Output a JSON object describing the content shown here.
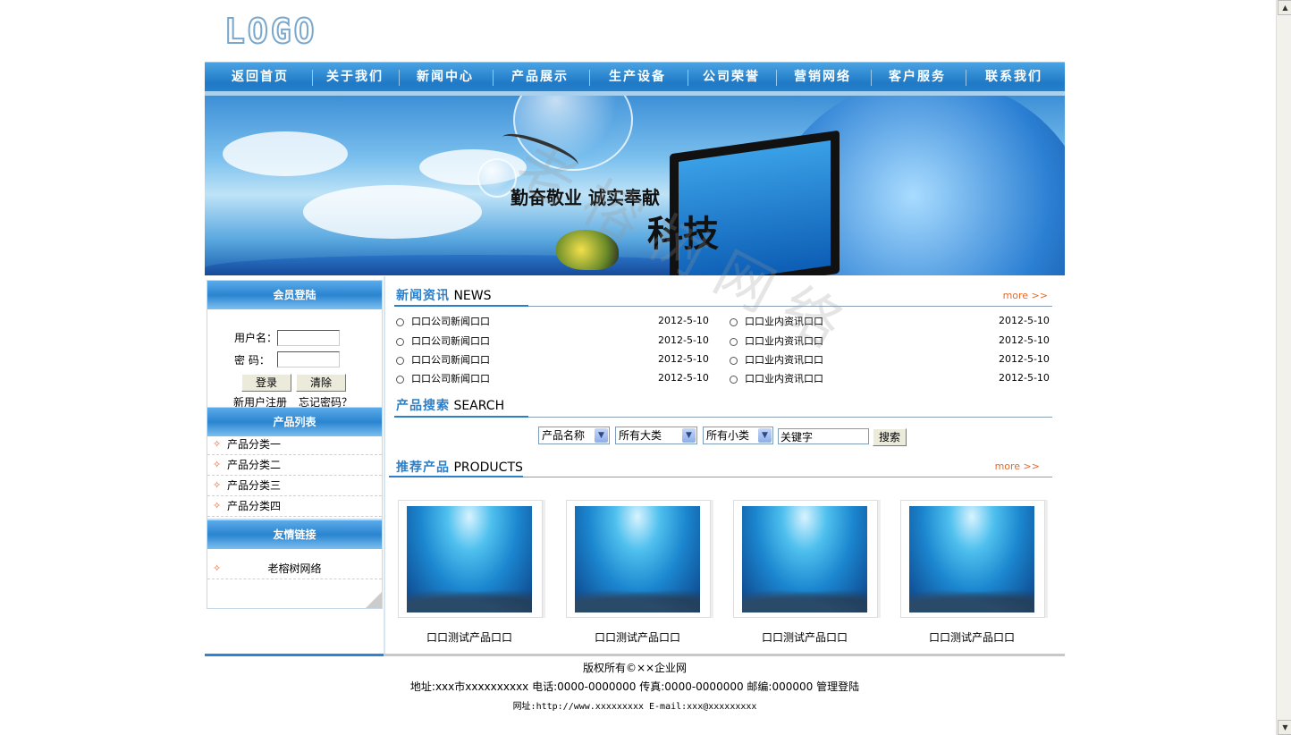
{
  "header": {
    "logo_text": "LOGO"
  },
  "nav": {
    "items": [
      {
        "label": "返回首页"
      },
      {
        "label": "关于我们"
      },
      {
        "label": "新闻中心"
      },
      {
        "label": "产品展示"
      },
      {
        "label": "生产设备"
      },
      {
        "label": "公司荣誉"
      },
      {
        "label": "营销网络"
      },
      {
        "label": "客户服务"
      },
      {
        "label": "联系我们"
      }
    ]
  },
  "banner": {
    "slogan": "勤奋敬业  诚实奉献",
    "slogan2": "科技"
  },
  "watermark": "老榕树网络",
  "login": {
    "title": "会员登陆",
    "username_label": "用户名：",
    "password_label": "密  码：",
    "login_button": "登录",
    "clear_button": "清除",
    "register_link": "新用户注册",
    "forgot_link": "忘记密码？"
  },
  "categories": {
    "title": "产品列表",
    "items": [
      {
        "label": "产品分类一"
      },
      {
        "label": "产品分类二"
      },
      {
        "label": "产品分类三"
      },
      {
        "label": "产品分类四"
      }
    ]
  },
  "links": {
    "title": "友情链接",
    "items": [
      {
        "label": "老榕树网络"
      }
    ]
  },
  "news": {
    "title_cn": "新闻资讯",
    "title_en": "NEWS",
    "more": "more >>",
    "company": [
      {
        "title": "口口公司新闻口口",
        "date": "2012-5-10"
      },
      {
        "title": "口口公司新闻口口",
        "date": "2012-5-10"
      },
      {
        "title": "口口公司新闻口口",
        "date": "2012-5-10"
      },
      {
        "title": "口口公司新闻口口",
        "date": "2012-5-10"
      }
    ],
    "industry": [
      {
        "title": "口口业内资讯口口",
        "date": "2012-5-10"
      },
      {
        "title": "口口业内资讯口口",
        "date": "2012-5-10"
      },
      {
        "title": "口口业内资讯口口",
        "date": "2012-5-10"
      },
      {
        "title": "口口业内资讯口口",
        "date": "2012-5-10"
      }
    ]
  },
  "search": {
    "title_cn": "产品搜索",
    "title_en": "SEARCH",
    "field_select": "产品名称",
    "major_select": "所有大类",
    "minor_select": "所有小类",
    "keyword_value": "关键字",
    "button": "搜索"
  },
  "products": {
    "title_cn": "推荐产品",
    "title_en": "PRODUCTS",
    "more": "more >>",
    "items": [
      {
        "name": "口口测试产品口口"
      },
      {
        "name": "口口测试产品口口"
      },
      {
        "name": "口口测试产品口口"
      },
      {
        "name": "口口测试产品口口"
      }
    ]
  },
  "footer": {
    "copyright": "版权所有©××企业网",
    "contact": "地址:xxx市xxxxxxxxxx 电话:0000-0000000   传真:0000-0000000   邮编:000000  管理登陆",
    "web": "网址:http://www.xxxxxxxxx  E-mail:xxx@xxxxxxxxx"
  },
  "scrollbar": {
    "up_glyph": "▲",
    "down_glyph": "▼"
  }
}
